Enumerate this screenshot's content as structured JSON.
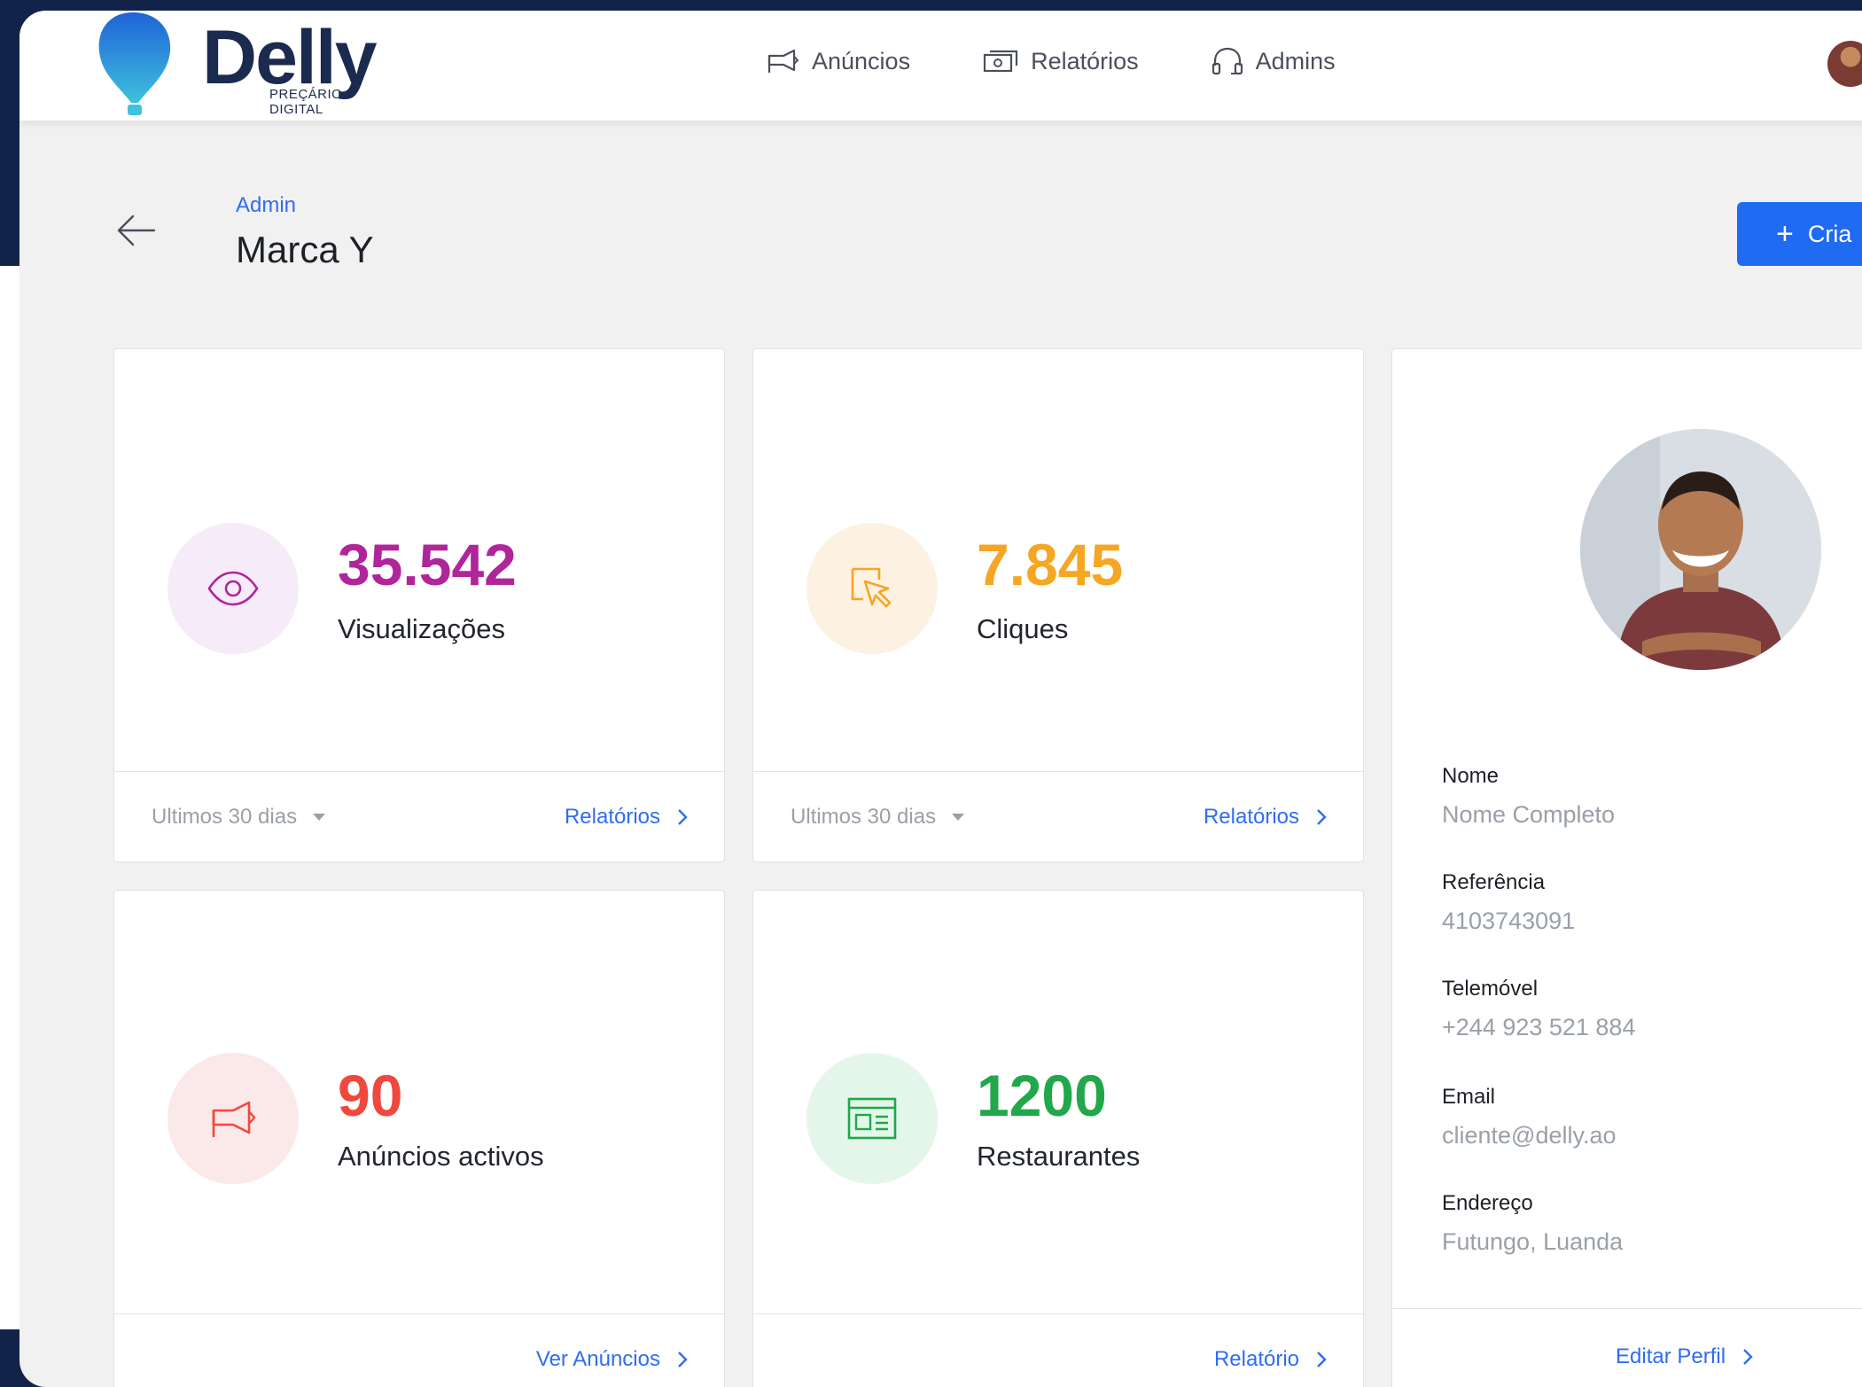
{
  "brand": {
    "name": "Delly",
    "tagline": "PREÇÁRIO DIGITAL"
  },
  "nav": [
    {
      "label": "Anúncios",
      "icon": "megaphone-icon"
    },
    {
      "label": "Relatórios",
      "icon": "cash-icon"
    },
    {
      "label": "Admins",
      "icon": "headset-icon"
    }
  ],
  "page": {
    "breadcrumb": "Admin",
    "title": "Marca Y",
    "create_button": "Cria"
  },
  "stats": [
    {
      "value": "35.542",
      "label": "Visualizações",
      "color": "#b0259a",
      "bg": "#f6ebf9",
      "icon": "eye-icon",
      "period": "Ultimos 30 dias",
      "link": "Relatórios"
    },
    {
      "value": "7.845",
      "label": "Cliques",
      "color": "#f5a623",
      "bg": "#fdf1e2",
      "icon": "cursor-click-icon",
      "period": "Ultimos 30 dias",
      "link": "Relatórios"
    },
    {
      "value": "90",
      "label": "Anúncios activos",
      "color": "#f0483e",
      "bg": "#fbe8e8",
      "icon": "megaphone-icon",
      "link": "Ver Anúncios"
    },
    {
      "value": "1200",
      "label": "Restaurantes",
      "color": "#20a84a",
      "bg": "#e4f6ea",
      "icon": "browser-window-icon",
      "link": "Relatório"
    }
  ],
  "profile": {
    "fields": [
      {
        "label": "Nome",
        "value": "Nome Completo"
      },
      {
        "label": "Referência",
        "value": "4103743091"
      },
      {
        "label": "Telemóvel",
        "value": "+244 923 521 884"
      },
      {
        "label": "Email",
        "value": "cliente@delly.ao"
      },
      {
        "label": "Endereço",
        "value": "Futungo, Luanda"
      }
    ],
    "edit_link": "Editar Perfil"
  }
}
